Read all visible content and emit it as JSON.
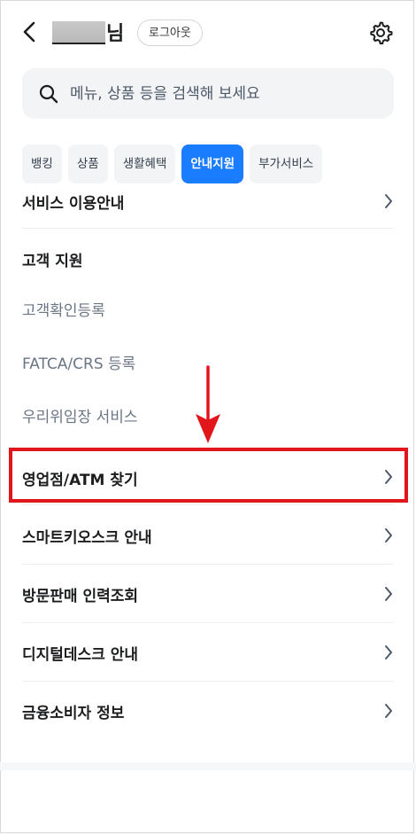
{
  "header": {
    "user_suffix": "님",
    "logout_label": "로그아웃"
  },
  "search": {
    "placeholder": "메뉴, 상품 등을 검색해 보세요"
  },
  "tabs": [
    {
      "label": "뱅킹",
      "active": false
    },
    {
      "label": "상품",
      "active": false
    },
    {
      "label": "생활혜택",
      "active": false
    },
    {
      "label": "안내지원",
      "active": true
    },
    {
      "label": "부가서비스",
      "active": false
    }
  ],
  "menu": {
    "service_guide": "서비스 이용안내",
    "customer_support_title": "고객 지원",
    "customer_register": "고객확인등록",
    "fatca": "FATCA/CRS 등록",
    "woori_proxy": "우리위임장 서비스",
    "branch_atm": "영업점/ATM 찾기",
    "smart_kiosk": "스마트키오스크 안내",
    "visit_sales": "방문판매 인력조회",
    "digital_desk": "디지털데스크 안내",
    "consumer_info": "금융소비자 정보"
  },
  "colors": {
    "accent": "#1a7cff",
    "highlight": "#e2151b"
  }
}
